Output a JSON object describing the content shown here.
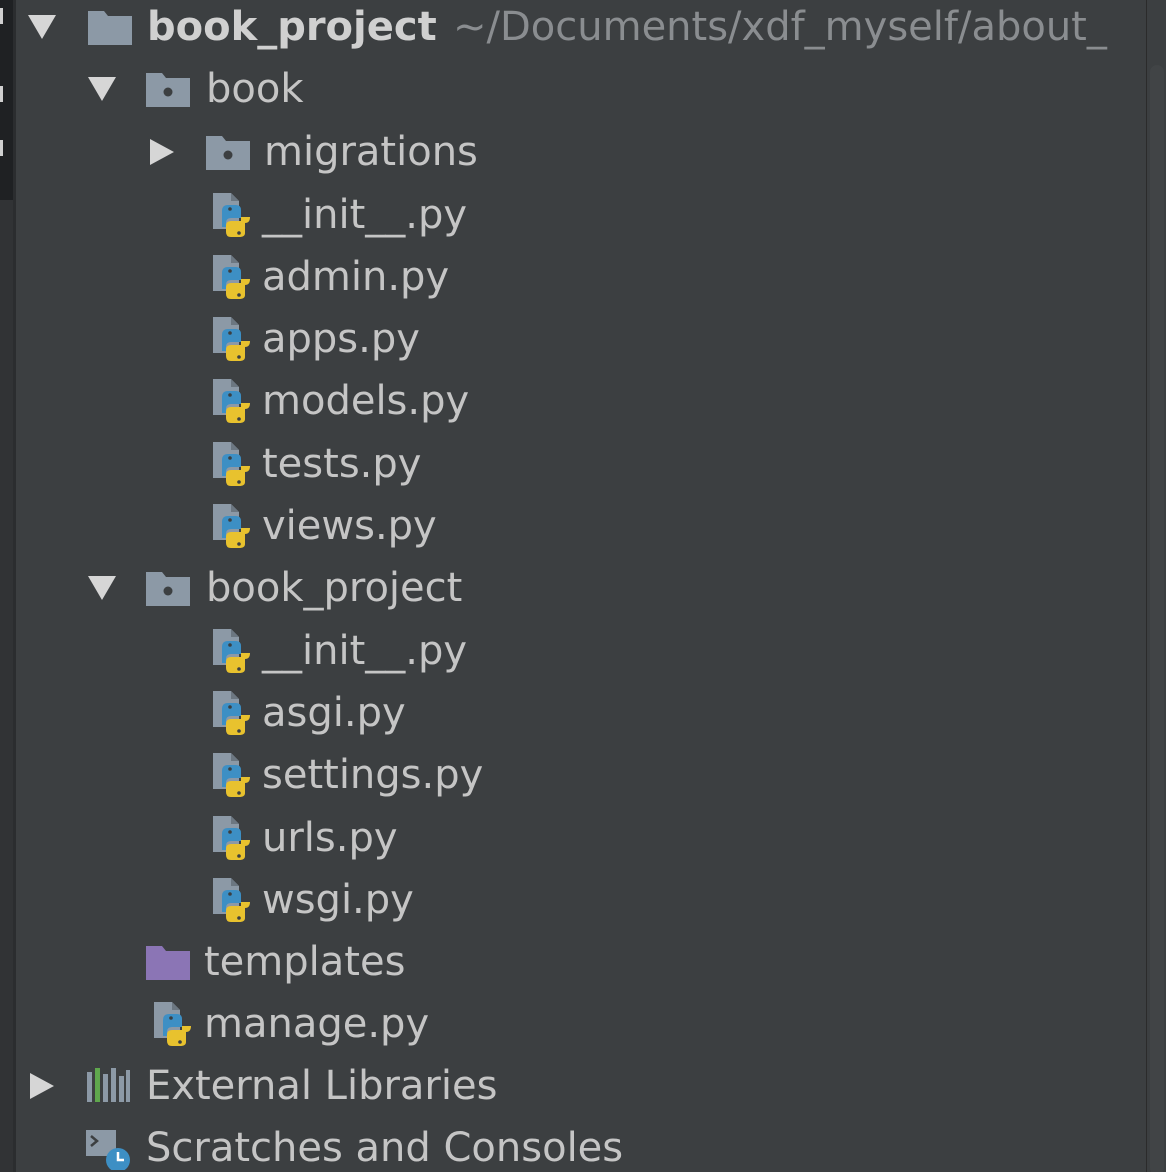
{
  "project_tree": {
    "root": {
      "name": "book_project",
      "path": "~/Documents/xdf_myself/about_"
    },
    "book_folder": {
      "name": "book",
      "subfolder": "migrations",
      "files": [
        "__init__.py",
        "admin.py",
        "apps.py",
        "models.py",
        "tests.py",
        "views.py"
      ]
    },
    "book_project_folder": {
      "name": "book_project",
      "files": [
        "__init__.py",
        "asgi.py",
        "settings.py",
        "urls.py",
        "wsgi.py"
      ]
    },
    "templates_folder": "templates",
    "manage_file": "manage.py",
    "external_libraries": "External Libraries",
    "scratches": "Scratches and Consoles"
  },
  "colors": {
    "background": "#3c3f41",
    "folder_gray": "#8c99a6",
    "templates_purple": "#8b75b5",
    "python_blue": "#3d8fc4",
    "python_yellow": "#e8c22e",
    "text": "#c5c5c5",
    "path_text": "#8a8d90"
  },
  "icons": {
    "root": "project-folder-icon",
    "package": "python-package-folder-icon",
    "templates": "templates-folder-icon",
    "python_file": "python-file-icon",
    "libraries": "external-libraries-icon",
    "scratches": "scratches-consoles-icon"
  }
}
